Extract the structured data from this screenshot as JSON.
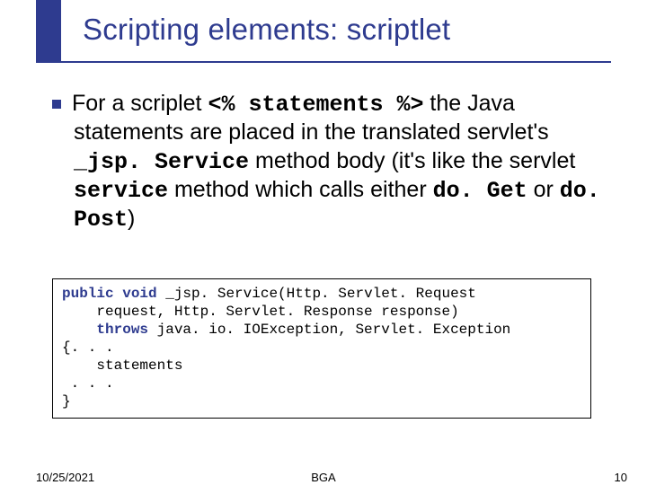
{
  "title": "Scripting elements: scriptlet",
  "para": {
    "t1": "For a scriplet ",
    "c1": "<% statements %>",
    "t2": " the Java statements are placed in the translated servlet's ",
    "c2": "_jsp. Service",
    "t3": " method body (it's like the servlet ",
    "c3": "service",
    "t4": " method which calls either ",
    "c4": "do. Get",
    "t5": " or ",
    "c5": "do. Post",
    "t6": ")"
  },
  "code": {
    "l1a": "public void",
    "l1b": " _jsp. Service(Http. Servlet. Request",
    "l2": "    request, Http. Servlet. Response response)",
    "l3a": "    throws",
    "l3b": " java. io. IOException, Servlet. Exception",
    "l4": "{. . .",
    "l5": "    statements",
    "l6": " . . .",
    "l7": "}"
  },
  "footer": {
    "date": "10/25/2021",
    "center": "BGA",
    "page": "10"
  }
}
